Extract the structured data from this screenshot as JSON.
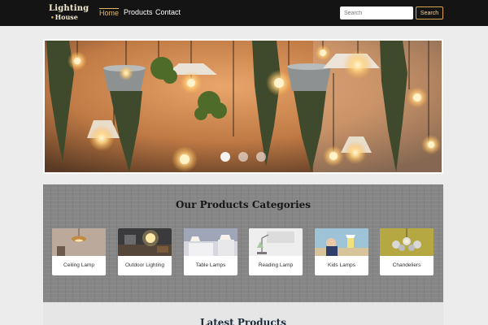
{
  "brand": {
    "line1": "Lighting",
    "line2": "House"
  },
  "nav": {
    "home": "Home",
    "products": "Products",
    "contact": "Contact"
  },
  "search": {
    "placeholder": "Search",
    "button_label": "Search"
  },
  "carousel": {
    "slide_count": 3,
    "active_index": 0
  },
  "categories": {
    "title": "Our Products Categories",
    "items": [
      {
        "label": "Ceiling Lamp"
      },
      {
        "label": "Outdoor Lighting"
      },
      {
        "label": "Table Lamps"
      },
      {
        "label": "Reading Lamp"
      },
      {
        "label": "Kids Lamps"
      },
      {
        "label": "Chandeliers"
      }
    ]
  },
  "latest": {
    "title": "Latest Products"
  },
  "colors": {
    "accent": "#e5b85b",
    "navbar": "#141414",
    "panel": "#868686"
  }
}
